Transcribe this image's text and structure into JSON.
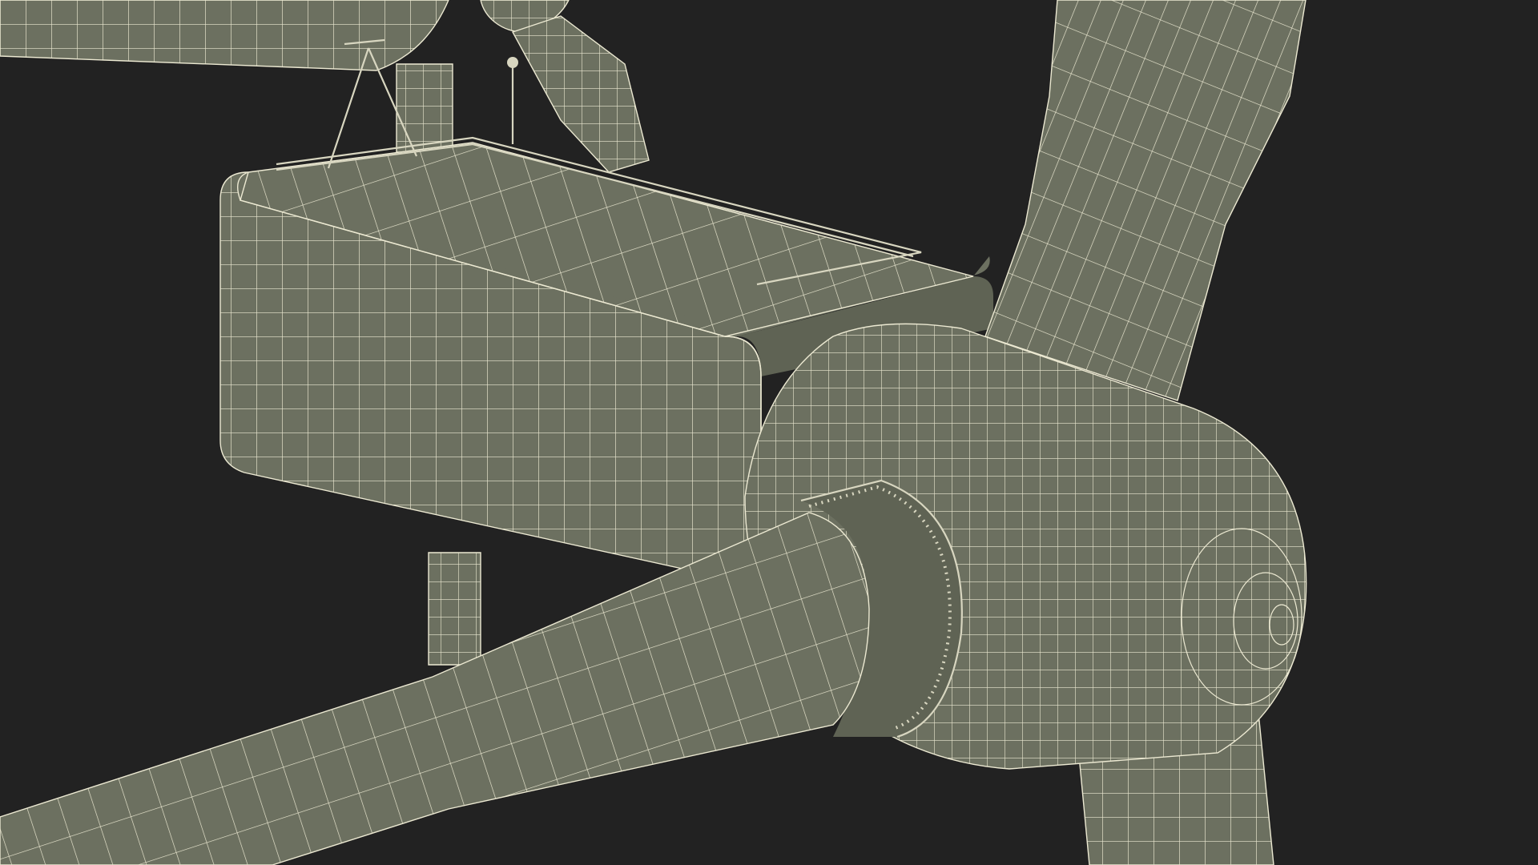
{
  "scene": {
    "subject": "wind-turbine-nacelle-wireframe",
    "colors": {
      "background": "#222222",
      "surface": "#6c7060",
      "surface_shadow": "#5f6354",
      "surface_dark": "#55594b",
      "wire": "#ece9d2",
      "rail": "#d8d6c0"
    }
  }
}
